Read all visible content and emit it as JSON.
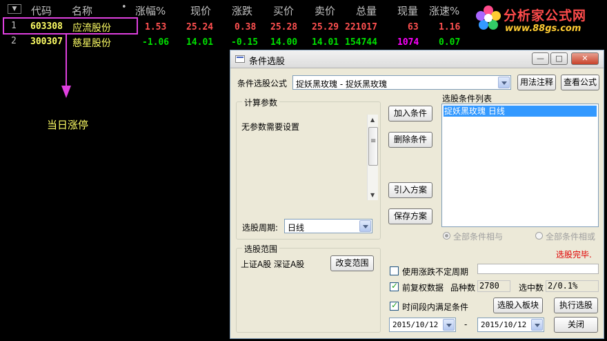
{
  "table": {
    "headers": [
      "代码",
      "名称",
      "涨幅%",
      "现价",
      "涨跌",
      "买价",
      "卖价",
      "总量",
      "现量",
      "涨速%"
    ],
    "rows": [
      {
        "n": "1",
        "code": "603308",
        "name": "应流股份",
        "chg_pct": "1.53",
        "price": "25.24",
        "chg": "0.38",
        "bid": "25.28",
        "ask": "25.29",
        "vol": "221017",
        "cur_vol": "63",
        "speed": "1.16"
      },
      {
        "n": "2",
        "code": "300307",
        "name": "慈星股份",
        "chg_pct": "-1.06",
        "price": "14.01",
        "chg": "-0.15",
        "bid": "14.00",
        "ask": "14.01",
        "vol": "154744",
        "cur_vol": "1074",
        "speed": "0.07"
      }
    ]
  },
  "annotation": {
    "text": "当日涨停"
  },
  "watermark": {
    "title": "分析家公式网",
    "url": "www.88gs.com"
  },
  "dialog": {
    "title": "条件选股",
    "formula_label": "条件选股公式",
    "formula_value": "捉妖黑玫瑰   - 捉妖黑玫瑰",
    "btn_usage": "用法注释",
    "btn_view": "查看公式",
    "params_group": "计算参数",
    "params_text": "无参数需要设置",
    "period_label": "选股周期:",
    "period_value": "日线",
    "btn_add": "加入条件",
    "btn_delete": "删除条件",
    "btn_import": "引入方案",
    "btn_save": "保存方案",
    "list_label": "选股条件列表",
    "list_items": [
      "捉妖黑玫瑰   日线"
    ],
    "radio_and": "全部条件相与",
    "radio_or": "全部条件相或",
    "status": "选股完毕.",
    "range_group": "选股范围",
    "range_text": "上证A股 深证A股",
    "btn_change_range": "改变范围",
    "chk_uncertain": "使用涨跌不定周期",
    "chk_restore": "前复权数据",
    "count_label": "品种数",
    "count_value": "2780",
    "selected_label": "选中数",
    "selected_value": "2/0.1%",
    "chk_period": "时间段内满足条件",
    "btn_to_block": "选股入板块",
    "btn_execute": "执行选股",
    "date_from": "2015/10/12",
    "date_sep": "-",
    "date_to": "2015/10/12",
    "btn_close": "关闭"
  }
}
